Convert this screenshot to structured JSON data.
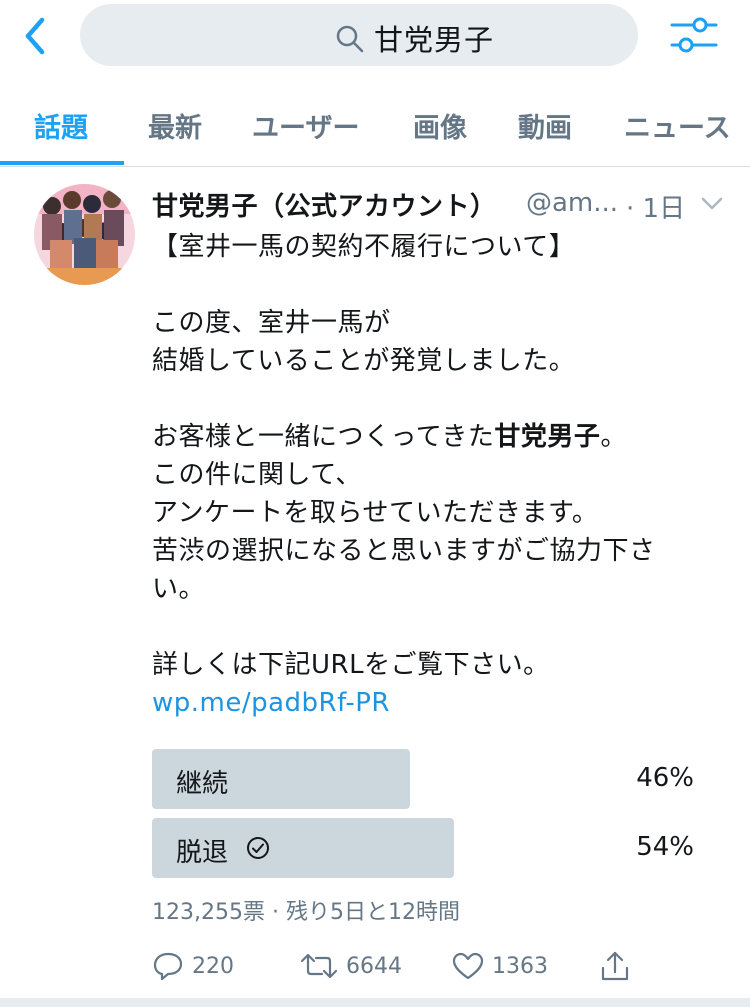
{
  "search": {
    "query": "甘党男子"
  },
  "tabs": [
    {
      "label": "話題"
    },
    {
      "label": "最新"
    },
    {
      "label": "ユーザー"
    },
    {
      "label": "画像"
    },
    {
      "label": "動画"
    },
    {
      "label": "ニュース"
    }
  ],
  "tweet": {
    "display_name": "甘党男子（公式アカウント）",
    "handle": "@am...",
    "timestamp": "· 1日",
    "body": {
      "line1": "【室井一馬の契約不履行について】",
      "line2": "この度、室井一馬が",
      "line3": "結婚していることが発覚しました。",
      "line4_pre": "お客様と一緒につくってきた",
      "line4_bold": "甘党男子",
      "line4_post": "。",
      "line5": "この件に関して、",
      "line6": "アンケートを取らせていただきます。",
      "line7": "苦渋の選択になると思いますがご協力下さ",
      "line8": "い。",
      "line9": "詳しくは下記URLをご覧下さい。",
      "link": "wp.me/padbRf-PR"
    },
    "poll": {
      "options": [
        {
          "label": "継続",
          "percent_text": "46%",
          "percent": 46,
          "selected": false
        },
        {
          "label": "脱退",
          "percent_text": "54%",
          "percent": 54,
          "selected": true
        }
      ],
      "meta": "123,255票 · 残り5日と12時間"
    },
    "actions": {
      "replies": "220",
      "retweets": "6644",
      "likes": "1363"
    }
  },
  "colors": {
    "accent": "#1da1f2",
    "link": "#1b95e0",
    "muted": "#657786",
    "poll_fill": "#ccd6dd",
    "search_bg": "#e6ecf0"
  },
  "icons": [
    "back-chevron-icon",
    "search-icon",
    "filter-sliders-icon",
    "chevron-down-icon",
    "check-circle-icon",
    "reply-icon",
    "retweet-icon",
    "like-icon",
    "share-icon"
  ]
}
